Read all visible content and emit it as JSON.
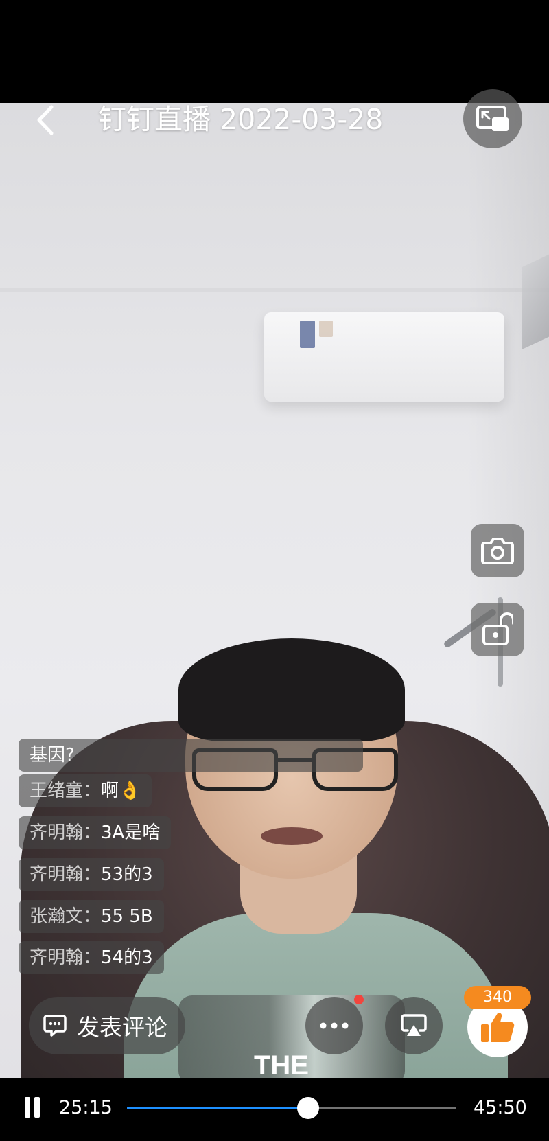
{
  "header": {
    "title": "钉钉直播 2022-03-28",
    "back_icon": "chevron-left-icon",
    "pip_icon": "picture-in-picture-icon"
  },
  "side_actions": [
    {
      "icon": "camera-icon"
    },
    {
      "icon": "unlock-icon"
    }
  ],
  "comments": [
    {
      "name": "",
      "text": "基因?"
    },
    {
      "name": "王绪童：",
      "text": "啊👌"
    },
    {
      "name": "齐明翰：",
      "text": "3A是啥"
    },
    {
      "name": "齐明翰：",
      "text": "53的3"
    },
    {
      "name": "张瀚文：",
      "text": "55 5B"
    },
    {
      "name": "齐明翰：",
      "text": "54的3"
    }
  ],
  "bottom_actions": {
    "comment_label": "发表评论",
    "comment_icon": "chat-bubble-icon",
    "more_icon": "more-dots-icon",
    "cast_icon": "screen-cast-icon",
    "like_icon": "thumbs-up-icon",
    "like_count": "340",
    "like_color": "#f58a1f"
  },
  "player": {
    "current_time": "25:15",
    "total_time": "45:50",
    "progress": 0.55,
    "accent_color": "#1e90ff"
  }
}
